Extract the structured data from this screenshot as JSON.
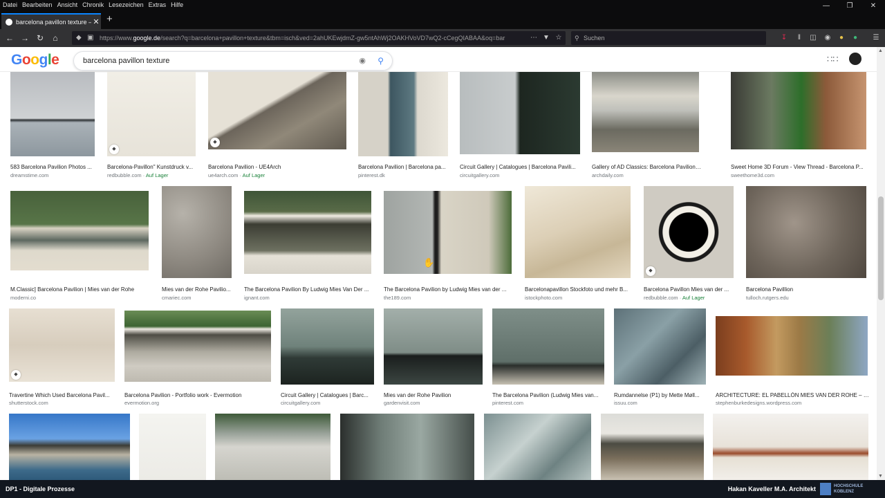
{
  "menubar": [
    "Datei",
    "Bearbeiten",
    "Ansicht",
    "Chronik",
    "Lesezeichen",
    "Extras",
    "Hilfe"
  ],
  "tab": {
    "title": "barcelona pavillon texture – Go",
    "close": "✕"
  },
  "newtab": "+",
  "url": {
    "prefix": "https://www.",
    "domain": "google.de",
    "rest": "/search?q=barcelona+pavillon+texture&tbm=isch&ved=2ahUKEwjdmZ-gw5ntAhWj2OAKHVoVD7wQ2-cCegQIABAA&oq=bar"
  },
  "browser_search_placeholder": "Suchen",
  "google": {
    "logo": [
      "G",
      "o",
      "o",
      "g",
      "l",
      "e"
    ],
    "logo_colors": [
      "#4285f4",
      "#ea4335",
      "#fbbc05",
      "#4285f4",
      "#34a853",
      "#ea4335"
    ],
    "query": "barcelona pavillon texture"
  },
  "results": [
    {
      "caption": "583 Barcelona Pavilion Photos ...",
      "source": "dreamstime.com",
      "stock": "",
      "bg": "linear-gradient(180deg,#b9bcc0 0%,#cfd2d4 55%,#2e3235 57%,#aab2b8 60%,#8d979e 100%)",
      "tag": false
    },
    {
      "caption": "Barcelona-Pavillon\" Kunstdruck v...",
      "source": "redbubble.com · ",
      "stock": "Auf Lager",
      "bg": "linear-gradient(180deg,#f1eee6,#e7e3d9)",
      "tag": true
    },
    {
      "caption": "Barcelona Pavilion - UE4Arch",
      "source": "ue4arch.com · ",
      "stock": "Auf Lager",
      "bg": "linear-gradient(150deg,#e6e1d6 0%,#e6e1d6 42%,#6c655b 46%,#908879 68%,#5f594f 100%)",
      "tag": true
    },
    {
      "caption": "Barcelona Pavilion | Barcelona pa...",
      "source": "pinterest.dk",
      "stock": "",
      "bg": "linear-gradient(90deg,#d6d2c8 0%,#d6d2c8 33%,#3d5660 36%,#5e7a82 62%,#dcd8ce 66%,#ece8de 100%)",
      "tag": false
    },
    {
      "caption": "Circuit Gallery | Catalogues | Barcelona Pavili...",
      "source": "circuitgallery.com",
      "stock": "",
      "bg": "linear-gradient(90deg,#b8bdbe 0%,#c8cccd 46%,#1d2620 50%,#2b3a31 100%)",
      "tag": false
    },
    {
      "caption": "Gallery of AD Classics: Barcelona Pavilion / Mie...",
      "source": "archdaily.com",
      "stock": "",
      "bg": "linear-gradient(180deg,#8b8d86 0%,#d9d6cc 30%,#bfc0ba 48%,#6b6a60 72%,#8a8578 100%)",
      "tag": false
    },
    {
      "caption": "Sweet Home 3D Forum - View Thread - Barcelona P...",
      "source": "sweethome3d.com",
      "stock": "",
      "bg": "linear-gradient(90deg,#3a3a35 0%,#6b7a61 30%,#2d6e2a 52%,#8c5a3a 70%,#c69470 100%)",
      "tag": false
    },
    {
      "caption": "M.Classic] Barcelona Pavilion | Mies van der Rohe",
      "source": "moderni.co",
      "stock": "",
      "bg": "linear-gradient(180deg,#48613b 0%,#587548 42%,#d8d2c3 47%,#5d6860 62%,#ded9cc 75%,#e3ddcf 100%)",
      "tag": false
    },
    {
      "caption": "Mies van der Rohe Pavilio...",
      "source": "cmariec.com",
      "stock": "",
      "bg": "radial-gradient(circle at 30% 30%,#b6b2aa,#8d8880 60%,#6f6b64 100%)",
      "tag": false
    },
    {
      "caption": "The Barcelona Pavilion By Ludwig Mies Van Der ...",
      "source": "ignant.com",
      "stock": "",
      "bg": "linear-gradient(180deg,#3f5538 0%,#596b48 25%,#f0ece4 30%,#3b3d33 40%,#6d7060 72%,#e6e2d8 78%,#d8d4ca 100%)",
      "tag": false
    },
    {
      "caption": "The Barcelona Pavilion by Ludwig Mies van der ...",
      "source": "the189.com",
      "stock": "",
      "bg": "linear-gradient(90deg,#9ea3a0 0%,#b3b7b4 38%,#1e1e1e 40%,#1e1e1e 42%,#d9d4c6 45%,#cfc9ba 82%,#4c6c3a 100%)",
      "tag": false
    },
    {
      "caption": "Barcelonapavillon Stockfoto und mehr B...",
      "source": "istockphoto.com",
      "stock": "",
      "bg": "linear-gradient(160deg,#efe8d8 0%,#dccfb6 45%,#c7b797 70%,#e3d7bf 100%)",
      "tag": false
    },
    {
      "caption": "Barcelona Pavillon Mies van der ...",
      "source": "redbubble.com · ",
      "stock": "Auf Lager",
      "bg": "radial-gradient(circle at 50% 50%,#000 0%,#000 30%,#f2efe6 31%,#f2efe6 40%,#1a1a1a 41%,#1a1a1a 46%,#cfcbc2 47%)",
      "tag": true
    },
    {
      "caption": "Barcelona Pavillion",
      "source": "tulloch.rutgers.edu",
      "stock": "",
      "bg": "radial-gradient(circle at 40% 40%,#a0958a,#6e655b 55%,#4f473f 100%)",
      "tag": false
    },
    {
      "caption": "Travertine Which Used Barcelona Pavil...",
      "source": "shutterstock.com",
      "stock": "",
      "bg": "linear-gradient(180deg,#e7dfd2,#d7cdbd 50%,#e9e2d6)",
      "tag": true
    },
    {
      "caption": "Barcelona Pavilion - Portfolio work - Evermotion",
      "source": "evermotion.org",
      "stock": "",
      "bg": "linear-gradient(180deg,#6a8c55 0%,#3d6432 22%,#eeeae2 26%,#4e4d45 34%,#aeaba0 58%,#cfcbc2 78%,#bebab0 100%)",
      "tag": false
    },
    {
      "caption": "Circuit Gallery | Catalogues | Barc...",
      "source": "circuitgallery.com",
      "stock": "",
      "bg": "linear-gradient(180deg,#93a39c 0%,#6f827b 50%,#2f3a36 65%,#1c2320 100%)",
      "tag": false
    },
    {
      "caption": "Mies van der Rohe Pavilion",
      "source": "gardenvisit.com",
      "stock": "",
      "bg": "linear-gradient(180deg,#a3afaa 0%,#7f8d87 58%,#1a1e1d 62%,#3c4642 100%)",
      "tag": false
    },
    {
      "caption": "The Barcelona Pavilion (Ludwig Mies van...",
      "source": "pinterest.com",
      "stock": "",
      "bg": "linear-gradient(180deg,#7f8f89,#5f6f69 70%,#2a2e2b 75%,#c6c0b2 100%)",
      "tag": false
    },
    {
      "caption": "Rumdannelse (P1) by Mette Møll...",
      "source": "issuu.com",
      "stock": "",
      "bg": "linear-gradient(135deg,#5d7178,#8aa0a6 40%,#4c5e65 70%,#9fb2b6 100%)",
      "tag": false
    },
    {
      "caption": "ARCHITECTURE: EL PABELLÓN MIES VAN DER ROHE – s...",
      "source": "stephenburkedesigns.wordpress.com",
      "stock": "",
      "bg": "linear-gradient(90deg,#7b3e1e 0%,#a85a2c 20%,#c39a60 40%,#9c7a46 55%,#6b7f58 75%,#8ea7c4 100%)",
      "tag": false
    },
    {
      "caption": "",
      "source": "",
      "stock": "",
      "bg": "linear-gradient(180deg,#3677c8 0%,#6aa2e3 38%,#3c3c36 48%,#b9b3a3 62%,#3d6a8a 85%,#2e5a7a 100%)",
      "tag": false
    },
    {
      "caption": "",
      "source": "",
      "stock": "",
      "bg": "linear-gradient(180deg,#f4f4f0,#ecebe6)",
      "tag": false
    },
    {
      "caption": "",
      "source": "",
      "stock": "",
      "bg": "linear-gradient(180deg,#3e5a39 0%,#9aa39a 30%,#d6d5cf 50%,#bdbdb5 100%)",
      "tag": false
    },
    {
      "caption": "",
      "source": "",
      "stock": "",
      "bg": "linear-gradient(90deg,#2b2f2d 0%,#6e7c76 30%,#9aa8a2 60%,#454e4a 100%)",
      "tag": false
    },
    {
      "caption": "",
      "source": "",
      "stock": "",
      "bg": "linear-gradient(135deg,#7c9091,#c6d1cf 40%,#6e8282 70%,#b6c4c2 100%)",
      "tag": false
    },
    {
      "caption": "",
      "source": "",
      "stock": "",
      "bg": "linear-gradient(180deg,#dcdcd8 0%,#e9e7e1 30%,#4b4b42 45%,#7b6f5c 68%,#c9c1b2 100%)",
      "tag": false
    },
    {
      "caption": "",
      "source": "",
      "stock": "",
      "bg": "linear-gradient(180deg,#f3f1ee 0%,#e8e2d9 50%,#9a4b2b 60%,#e6e0d4 66%,#f2efea 100%)",
      "tag": false
    }
  ],
  "footer": {
    "left": "DP1 - Digitale Prozesse",
    "right": "Hakan Kaveller M.A. Architekt",
    "logo_line1": "HOCHSCHULE",
    "logo_line2": "KOBLENZ"
  }
}
